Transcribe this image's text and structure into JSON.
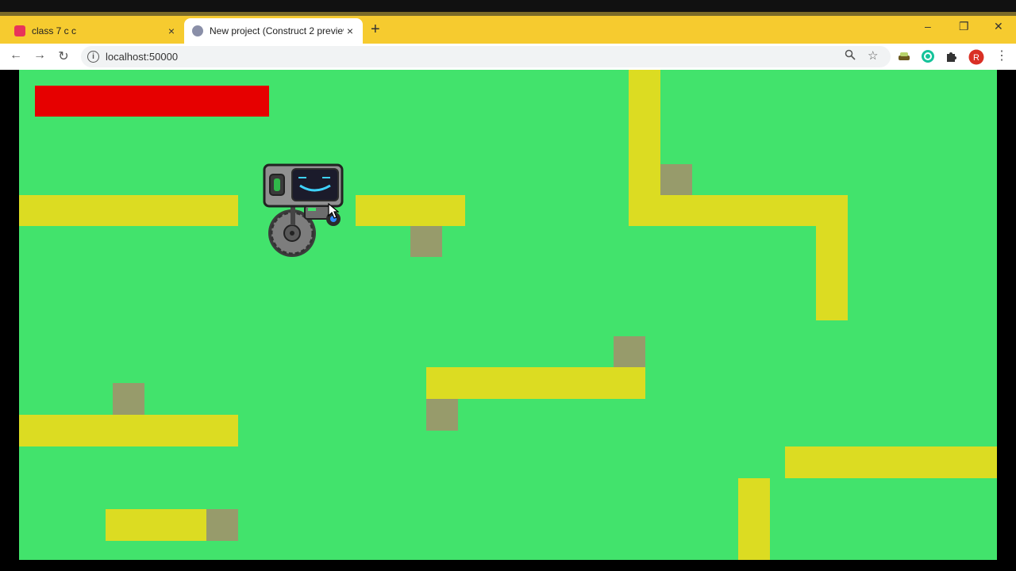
{
  "browser": {
    "tabs": [
      {
        "title": "class 7 c c",
        "active": false,
        "favicon_color": "#e8345a"
      },
      {
        "title": "New project (Construct 2 preview",
        "active": true,
        "favicon_color": "#8a8fa8"
      }
    ],
    "new_tab_label": "+",
    "close_glyph": "×",
    "window_controls": {
      "minimize": "–",
      "restore": "❐",
      "close": "✕"
    },
    "address": "localhost:50000",
    "profile_initial": "R",
    "accent_color": "#f6cb2f"
  },
  "game": {
    "background_color": "#42e36c",
    "platform_color": "#dcdc22",
    "box_color": "#979b6b",
    "health_bar_color": "#e60000",
    "player": "robot"
  }
}
